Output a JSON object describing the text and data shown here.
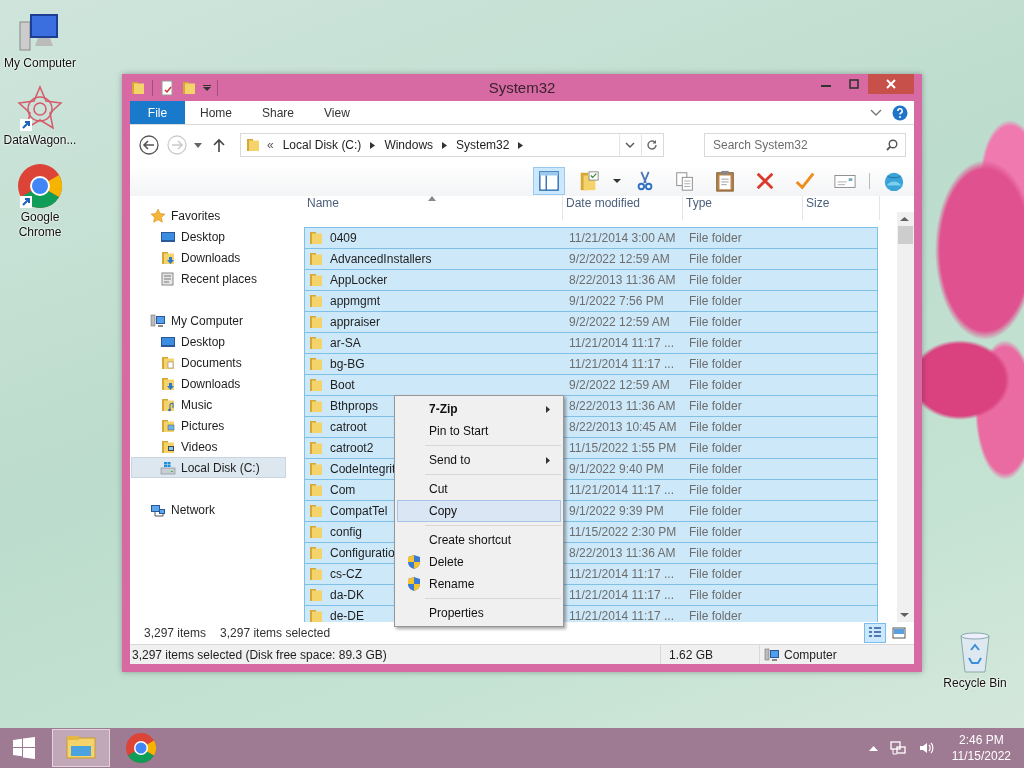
{
  "desktop_icons": [
    {
      "label": "My Computer",
      "kind": "computer"
    },
    {
      "label": "DataWagon...",
      "kind": "star-shortcut"
    },
    {
      "label": "Google Chrome",
      "kind": "chrome"
    },
    {
      "label": "Recycle Bin",
      "kind": "recycle-bin"
    }
  ],
  "window": {
    "title": "System32"
  },
  "ribbon": {
    "tabs": [
      {
        "label": "File",
        "kind": "file"
      },
      {
        "label": "Home",
        "kind": "tab"
      },
      {
        "label": "Share",
        "kind": "tab"
      },
      {
        "label": "View",
        "kind": "tab"
      }
    ]
  },
  "address": {
    "overflow": "«",
    "segments": [
      "Local Disk (C:)",
      "Windows",
      "System32"
    ]
  },
  "search": {
    "placeholder": "Search System32"
  },
  "toolbar": [
    {
      "kind": "pane",
      "on": true
    },
    {
      "kind": "folder-options"
    },
    {
      "kind": "cut"
    },
    {
      "kind": "copy"
    },
    {
      "kind": "paste"
    },
    {
      "kind": "delete"
    },
    {
      "kind": "check"
    },
    {
      "kind": "card"
    },
    {
      "kind": "globe"
    }
  ],
  "navigation": [
    {
      "label": "Favorites",
      "kind": "favorites",
      "selected": false,
      "children": [
        {
          "label": "Desktop",
          "kind": "desktop",
          "selected": false
        },
        {
          "label": "Downloads",
          "kind": "downloads",
          "selected": false
        },
        {
          "label": "Recent places",
          "kind": "recent",
          "selected": false
        }
      ]
    },
    {
      "label": "My Computer",
      "kind": "computer",
      "selected": false,
      "children": [
        {
          "label": "Desktop",
          "kind": "desktop",
          "selected": false
        },
        {
          "label": "Documents",
          "kind": "documents",
          "selected": false
        },
        {
          "label": "Downloads",
          "kind": "downloads",
          "selected": false
        },
        {
          "label": "Music",
          "kind": "music",
          "selected": false
        },
        {
          "label": "Pictures",
          "kind": "pictures",
          "selected": false
        },
        {
          "label": "Videos",
          "kind": "videos",
          "selected": false
        },
        {
          "label": "Local Disk (C:)",
          "kind": "drive",
          "selected": true
        }
      ]
    },
    {
      "label": "Network",
      "kind": "network",
      "selected": false
    }
  ],
  "table": {
    "columns": [
      "Name",
      "Date modified",
      "Type",
      "Size"
    ],
    "rows": [
      {
        "name": "0409",
        "date": "11/21/2014 3:00 AM",
        "type": "File folder",
        "selected": true
      },
      {
        "name": "AdvancedInstallers",
        "date": "9/2/2022 12:59 AM",
        "type": "File folder",
        "selected": true
      },
      {
        "name": "AppLocker",
        "date": "8/22/2013 11:36 AM",
        "type": "File folder",
        "selected": true
      },
      {
        "name": "appmgmt",
        "date": "9/1/2022 7:56 PM",
        "type": "File folder",
        "selected": true
      },
      {
        "name": "appraiser",
        "date": "9/2/2022 12:59 AM",
        "type": "File folder",
        "selected": true
      },
      {
        "name": "ar-SA",
        "date": "11/21/2014 11:17 ...",
        "type": "File folder",
        "selected": true
      },
      {
        "name": "bg-BG",
        "date": "11/21/2014 11:17 ...",
        "type": "File folder",
        "selected": true
      },
      {
        "name": "Boot",
        "date": "9/2/2022 12:59 AM",
        "type": "File folder",
        "selected": true
      },
      {
        "name": "Bthprops",
        "date": "8/22/2013 11:36 AM",
        "type": "File folder",
        "selected": true
      },
      {
        "name": "catroot",
        "date": "8/22/2013 10:45 AM",
        "type": "File folder",
        "selected": true
      },
      {
        "name": "catroot2",
        "date": "11/15/2022 1:55 PM",
        "type": "File folder",
        "selected": true
      },
      {
        "name": "CodeIntegrit",
        "date": "9/1/2022 9:40 PM",
        "type": "File folder",
        "selected": true
      },
      {
        "name": "Com",
        "date": "11/21/2014 11:17 ...",
        "type": "File folder",
        "selected": true
      },
      {
        "name": "CompatTel",
        "date": "9/1/2022 9:39 PM",
        "type": "File folder",
        "selected": true
      },
      {
        "name": "config",
        "date": "11/15/2022 2:30 PM",
        "type": "File folder",
        "selected": true
      },
      {
        "name": "Configuratio",
        "date": "8/22/2013 11:36 AM",
        "type": "File folder",
        "selected": true
      },
      {
        "name": "cs-CZ",
        "date": "11/21/2014 11:17 ...",
        "type": "File folder",
        "selected": true
      },
      {
        "name": "da-DK",
        "date": "11/21/2014 11:17 ...",
        "type": "File folder",
        "selected": true
      },
      {
        "name": "de-DE",
        "date": "11/21/2014 11:17 ...",
        "type": "File folder",
        "selected": true
      }
    ]
  },
  "status": {
    "items": "3,297 items",
    "selected": "3,297 items selected"
  },
  "view_buttons": [
    {
      "kind": "details",
      "selected": true
    },
    {
      "kind": "large-icons",
      "selected": false
    }
  ],
  "status_bar": {
    "text": "3,297 items selected (Disk free space: 89.3 GB)",
    "size": "1.62 GB",
    "zone": "Computer"
  },
  "context_menu": [
    {
      "kind": "item",
      "label": "7-Zip",
      "bold": true,
      "submenu": true,
      "shield": false,
      "selected": false
    },
    {
      "kind": "item",
      "label": "Pin to Start",
      "bold": false,
      "submenu": false,
      "shield": false,
      "selected": false
    },
    {
      "kind": "separator"
    },
    {
      "kind": "item",
      "label": "Send to",
      "bold": false,
      "submenu": true,
      "shield": false,
      "selected": false
    },
    {
      "kind": "separator"
    },
    {
      "kind": "item",
      "label": "Cut",
      "bold": false,
      "submenu": false,
      "shield": false,
      "selected": false
    },
    {
      "kind": "item",
      "label": "Copy",
      "bold": false,
      "submenu": false,
      "shield": false,
      "selected": true
    },
    {
      "kind": "separator"
    },
    {
      "kind": "item",
      "label": "Create shortcut",
      "bold": false,
      "submenu": false,
      "shield": false,
      "selected": false
    },
    {
      "kind": "item",
      "label": "Delete",
      "bold": false,
      "submenu": false,
      "shield": true,
      "selected": false
    },
    {
      "kind": "item",
      "label": "Rename",
      "bold": false,
      "submenu": false,
      "shield": true,
      "selected": false
    },
    {
      "kind": "separator"
    },
    {
      "kind": "item",
      "label": "Properties",
      "bold": false,
      "submenu": false,
      "shield": false,
      "selected": false
    }
  ],
  "taskbar": {
    "apps": [
      {
        "kind": "explorer",
        "selected": true
      },
      {
        "kind": "chrome",
        "selected": false
      }
    ],
    "tray": {
      "time": "2:46 PM",
      "date": "11/15/2022"
    }
  }
}
